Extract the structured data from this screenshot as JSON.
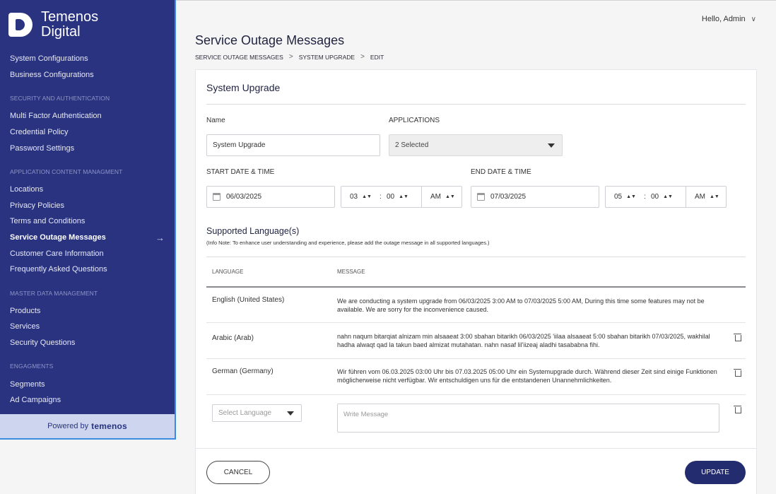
{
  "brand": {
    "line1": "Temenos",
    "line2": "Digital",
    "powered_prefix": "Powered by",
    "powered_name": "temenos"
  },
  "sidebar": {
    "top_items": [
      "System Configurations",
      "Business Configurations"
    ],
    "sections": [
      {
        "title": "SECURITY AND AUTHENTICATION",
        "items": [
          "Multi Factor Authentication",
          "Credential Policy",
          "Password Settings"
        ]
      },
      {
        "title": "APPLICATION CONTENT MANAGMENT",
        "items": [
          "Locations",
          "Privacy Policies",
          "Terms and Conditions",
          "Service Outage Messages",
          "Customer Care Information",
          "Frequently Asked Questions"
        ]
      },
      {
        "title": "MASTER DATA MANAGEMENT",
        "items": [
          "Products",
          "Services",
          "Security Questions"
        ]
      },
      {
        "title": "ENGAGMENTS",
        "items": [
          "Segments",
          "Ad Campaigns"
        ]
      }
    ],
    "active_item": "Service Outage Messages",
    "active_arrow": "→"
  },
  "header": {
    "greeting": "Hello, Admin",
    "chevron": "∨"
  },
  "page": {
    "title": "Service Outage Messages",
    "breadcrumb": [
      "SERVICE OUTAGE MESSAGES",
      "SYSTEM UPGRADE",
      "EDIT"
    ],
    "breadcrumb_sep": ">"
  },
  "form": {
    "card_title": "System Upgrade",
    "name_label": "Name",
    "name_value": "System Upgrade",
    "applications_label": "APPLICATIONS",
    "applications_value": "2 Selected",
    "start_label": "START DATE & TIME",
    "start_date": "06/03/2025",
    "start_hour": "03",
    "start_minute": "00",
    "start_ampm": "AM",
    "end_label": "END DATE & TIME",
    "end_date": "07/03/2025",
    "end_hour": "05",
    "end_minute": "00",
    "end_ampm": "AM",
    "time_sep": ":"
  },
  "languages": {
    "title": "Supported Language(s)",
    "note": "(Info Note: To enhance user understanding and experience, please add the outage message in all supported languages.)",
    "col_language": "LANGUAGE",
    "col_message": "MESSAGE",
    "rows": [
      {
        "language": "English (United States)",
        "message": "We are conducting a system upgrade from 06/03/2025 3:00 AM to 07/03/2025 5:00 AM, During this time some features may not be available. We are sorry for the inconvenience caused."
      },
      {
        "language": "Arabic (Arab)",
        "message": "nahn naqum bitarqiat alnizam min alsaaeat 3:00 sbahan bitarikh 06/03/2025 'iilaa alsaaeat 5:00 sbahan bitarikh 07/03/2025, wakhilal hadha alwaqt qad la takun baed almizat mutahatan. nahn nasaf lil'iizeaj aladhi tasababna fihi."
      },
      {
        "language": "German (Germany)",
        "message": "Wir führen vom 06.03.2025 03:00 Uhr bis 07.03.2025 05:00 Uhr ein Systemupgrade durch. Während dieser Zeit sind einige Funktionen möglicherweise nicht verfügbar. Wir entschuldigen uns für die entstandenen Unannehmlichkeiten."
      }
    ],
    "select_placeholder": "Select Language",
    "message_placeholder": "Write Message"
  },
  "actions": {
    "cancel": "CANCEL",
    "update": "UPDATE"
  }
}
